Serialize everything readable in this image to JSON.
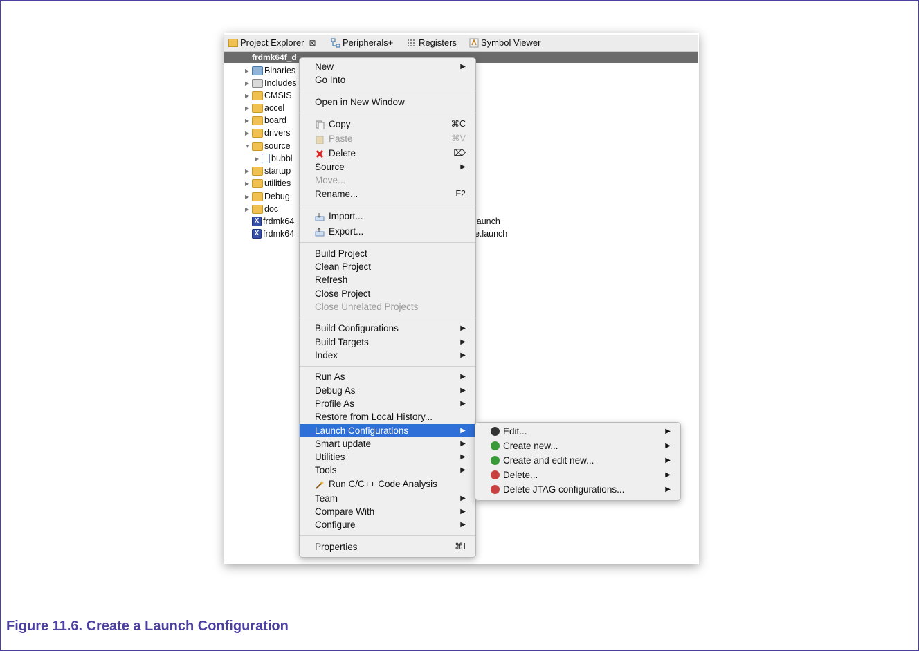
{
  "tabs": [
    {
      "label": "Project Explorer",
      "icon": "folder-icon",
      "close": "⊠"
    },
    {
      "label": "Peripherals+",
      "icon": "peripherals-icon"
    },
    {
      "label": "Registers",
      "icon": "registers-icon"
    },
    {
      "label": "Symbol Viewer",
      "icon": "symbol-viewer-icon"
    }
  ],
  "project_name": "frdmk64f_d",
  "tree": [
    {
      "label": "Binaries",
      "kind": "bin"
    },
    {
      "label": "Includes",
      "kind": "inc"
    },
    {
      "label": "CMSIS",
      "kind": "folder"
    },
    {
      "label": "accel",
      "kind": "folder"
    },
    {
      "label": "board",
      "kind": "folder"
    },
    {
      "label": "drivers",
      "kind": "folder"
    },
    {
      "label": "source",
      "kind": "folder"
    },
    {
      "label": "bubbl",
      "kind": "file"
    },
    {
      "label": "startup",
      "kind": "folder"
    },
    {
      "label": "utilities",
      "kind": "folder"
    },
    {
      "label": "Debug",
      "kind": "folder"
    },
    {
      "label": "doc",
      "kind": "folder"
    },
    {
      "label": "frdmk64",
      "kind": "launch",
      "suffix": "launch"
    },
    {
      "label": "frdmk64",
      "kind": "launch",
      "suffix": "e.launch"
    }
  ],
  "menu": {
    "new": "New",
    "go_into": "Go Into",
    "open_new_window": "Open in New Window",
    "copy": "Copy",
    "copy_sc": "⌘C",
    "paste": "Paste",
    "paste_sc": "⌘V",
    "delete": "Delete",
    "delete_sc": "⌦",
    "source": "Source",
    "move": "Move...",
    "rename": "Rename...",
    "rename_sc": "F2",
    "import": "Import...",
    "export": "Export...",
    "build_project": "Build Project",
    "clean_project": "Clean Project",
    "refresh": "Refresh",
    "close_project": "Close Project",
    "close_unrelated": "Close Unrelated Projects",
    "build_configurations": "Build Configurations",
    "build_targets": "Build Targets",
    "index": "Index",
    "run_as": "Run As",
    "debug_as": "Debug As",
    "profile_as": "Profile As",
    "restore_history": "Restore from Local History...",
    "launch_configurations": "Launch Configurations",
    "smart_update": "Smart update",
    "utilities": "Utilities",
    "tools": "Tools",
    "code_analysis": "Run C/C++ Code Analysis",
    "team": "Team",
    "compare_with": "Compare With",
    "configure": "Configure",
    "properties": "Properties",
    "properties_sc": "⌘I"
  },
  "submenu": {
    "edit": "Edit...",
    "create_new": "Create new...",
    "create_edit_new": "Create and edit new...",
    "delete": "Delete...",
    "delete_jtag": "Delete JTAG configurations..."
  },
  "caption": "Figure 11.6. Create a Launch Configuration",
  "colors": {
    "accent": "#4b3fa0",
    "selection": "#2f6fd8"
  }
}
